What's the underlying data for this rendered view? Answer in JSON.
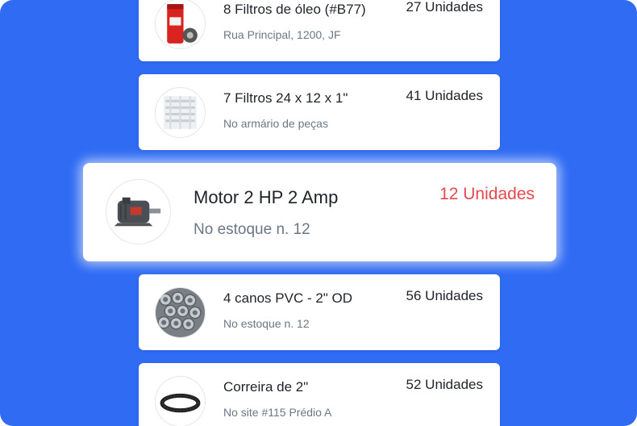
{
  "colors": {
    "background": "#2f6bf3",
    "card": "#ffffff",
    "alert_quantity": "#e5484d"
  },
  "items": [
    {
      "title": "8 Filtros de óleo (#B77)",
      "location": "Rua Principal, 1200, JF",
      "quantity": "27 Unidades",
      "icon": "oil-filter-icon"
    },
    {
      "title": "7 Filtros 24 x 12 x 1\"",
      "location": "No armário de peças",
      "quantity": "41 Unidades",
      "icon": "air-filter-icon"
    },
    {
      "title": "Motor 2 HP 2 Amp",
      "location": "No estoque n. 12",
      "quantity": "12 Unidades",
      "icon": "electric-motor-icon",
      "highlighted": true
    },
    {
      "title": "4 canos PVC - 2\" OD",
      "location": "No estoque n. 12",
      "quantity": "56 Unidades",
      "icon": "pipes-icon"
    },
    {
      "title": "Correira de 2\"",
      "location": "No site #115 Prédio A",
      "quantity": "52 Unidades",
      "icon": "belt-icon"
    }
  ]
}
